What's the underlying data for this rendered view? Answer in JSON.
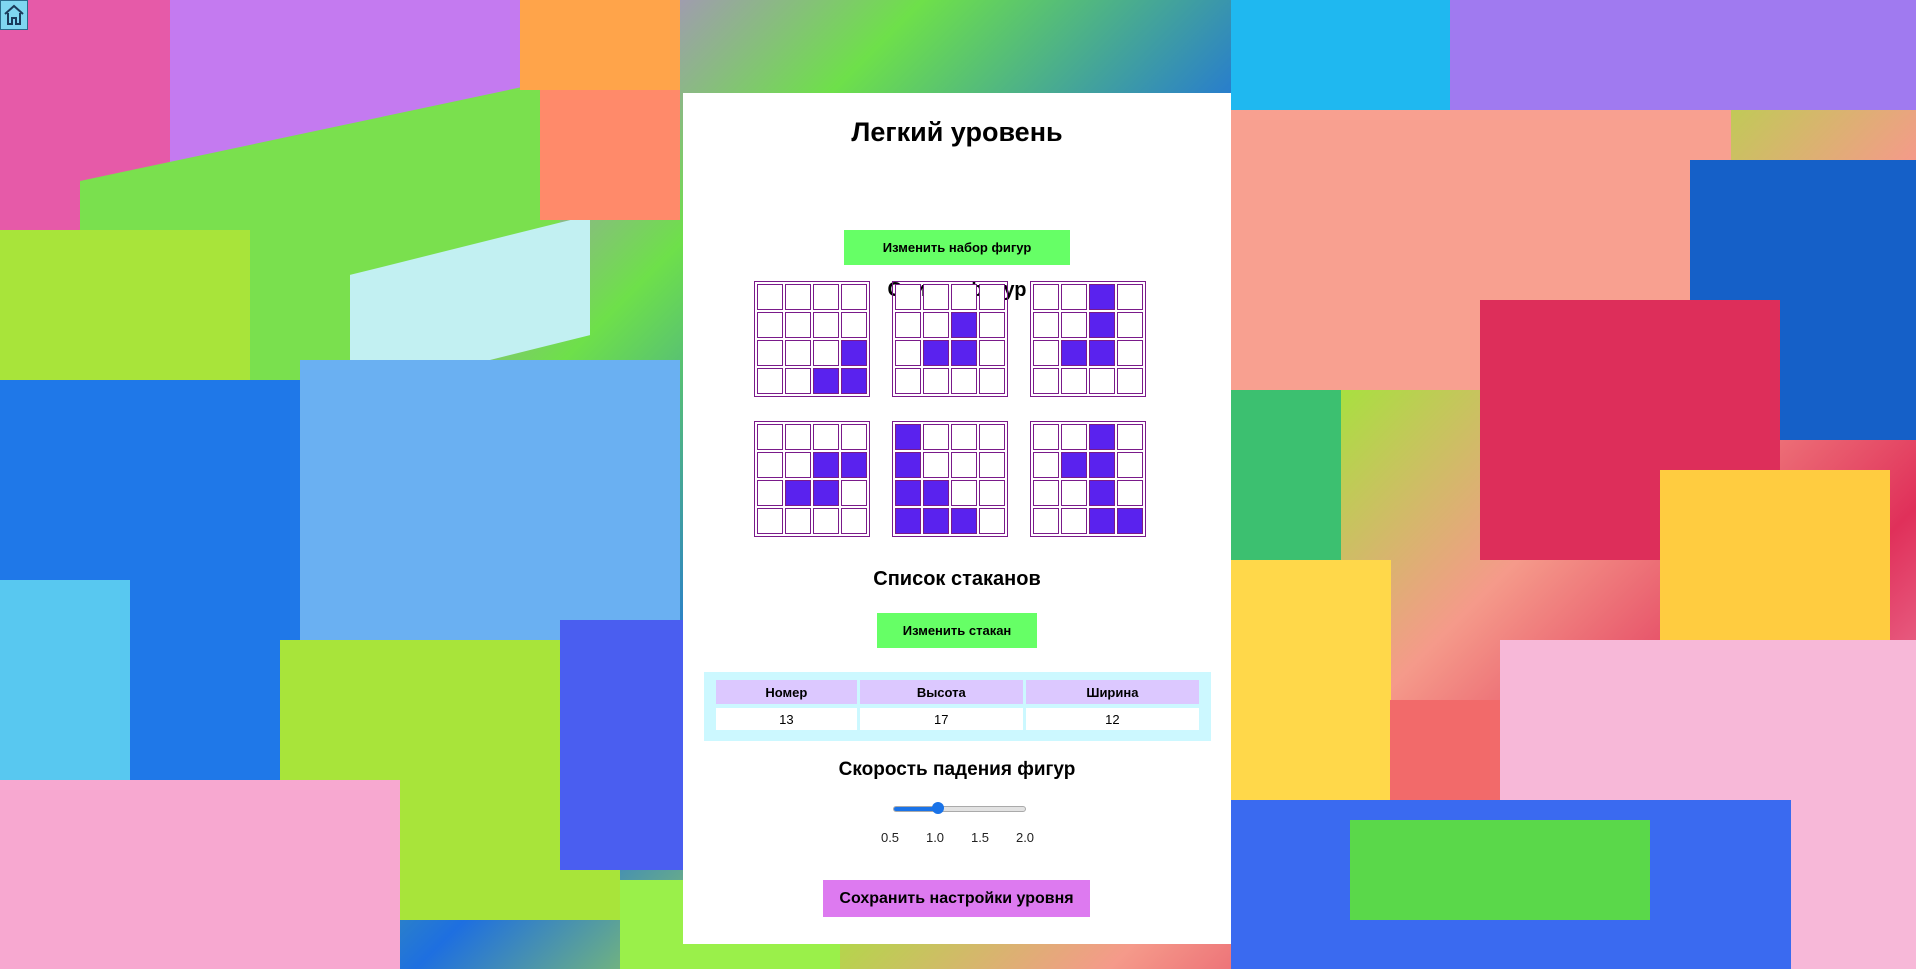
{
  "page": {
    "title": "Легкий уровень"
  },
  "figures": {
    "heading": "Список фигур",
    "change_button": "Изменить набор фигур",
    "items": [
      [
        [
          0,
          0,
          0,
          0
        ],
        [
          0,
          0,
          0,
          0
        ],
        [
          0,
          0,
          0,
          1
        ],
        [
          0,
          0,
          1,
          1
        ]
      ],
      [
        [
          0,
          0,
          0,
          0
        ],
        [
          0,
          0,
          1,
          0
        ],
        [
          0,
          1,
          1,
          0
        ],
        [
          0,
          0,
          0,
          0
        ]
      ],
      [
        [
          0,
          0,
          1,
          0
        ],
        [
          0,
          0,
          1,
          0
        ],
        [
          0,
          1,
          1,
          0
        ],
        [
          0,
          0,
          0,
          0
        ]
      ],
      [
        [
          0,
          0,
          0,
          0
        ],
        [
          0,
          0,
          1,
          1
        ],
        [
          0,
          1,
          1,
          0
        ],
        [
          0,
          0,
          0,
          0
        ]
      ],
      [
        [
          1,
          0,
          0,
          0
        ],
        [
          1,
          0,
          0,
          0
        ],
        [
          1,
          1,
          0,
          0
        ],
        [
          1,
          1,
          1,
          0
        ]
      ],
      [
        [
          0,
          0,
          1,
          0
        ],
        [
          0,
          1,
          1,
          0
        ],
        [
          0,
          0,
          1,
          0
        ],
        [
          0,
          0,
          1,
          1
        ]
      ]
    ],
    "colors": {
      "filled": "#5a22ee",
      "border": "#7a1a8a"
    }
  },
  "glasses": {
    "heading": "Список стаканов",
    "change_button": "Изменить стакан",
    "columns": [
      "Номер",
      "Высота",
      "Ширина"
    ],
    "rows": [
      [
        "13",
        "17",
        "12"
      ]
    ]
  },
  "speed": {
    "heading": "Скорость падения фигур",
    "value": 1.0,
    "min": 0.5,
    "max": 2.0,
    "tick_labels": [
      "0.5",
      "1.0",
      "1.5",
      "2.0"
    ]
  },
  "save_button": "Сохранить настройки уровня",
  "icons": {
    "home": "home-icon"
  }
}
